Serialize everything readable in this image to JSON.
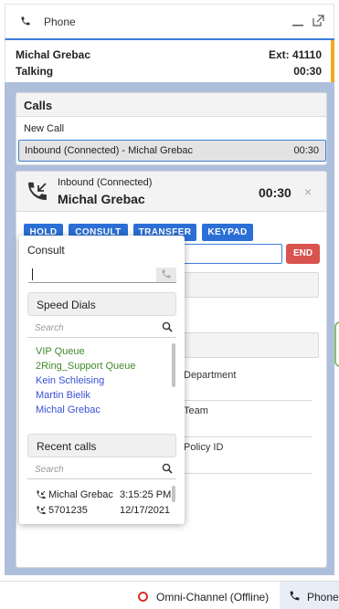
{
  "window": {
    "title": "Phone"
  },
  "status": {
    "name": "Michal Grebac",
    "ext": "Ext: 41110",
    "state": "Talking",
    "timer": "00:30"
  },
  "calls": {
    "header": "Calls",
    "new_call": "New Call",
    "active_call": {
      "label": "Inbound (Connected) - Michal Grebac",
      "time": "00:30"
    }
  },
  "detail": {
    "direction": "Inbound (Connected)",
    "name": "Michal Grebac",
    "timer": "00:30",
    "close": "×",
    "buttons": [
      "HOLD",
      "CONSULT",
      "TRANSFER",
      "KEYPAD"
    ],
    "end_button": "END",
    "labels": [
      "Department",
      "Team",
      "Policy ID"
    ]
  },
  "consult": {
    "title": "Consult",
    "speed_dials_header": "Speed Dials",
    "search_placeholder": "Search",
    "speed_dials": [
      {
        "label": "VIP Queue",
        "color": "#3f8a2a"
      },
      {
        "label": "2Ring_Support Queue",
        "color": "#3f8a2a"
      },
      {
        "label": "Kein Schleising",
        "color": "#3850d6"
      },
      {
        "label": "Martin Bielik",
        "color": "#3850d6"
      },
      {
        "label": "Michal Grebac",
        "color": "#3850d6"
      }
    ],
    "recent_header": "Recent calls",
    "recent_search_placeholder": "Search",
    "recent_calls": [
      {
        "name": "Michal Grebac",
        "time": "3:15:25 PM"
      },
      {
        "name": "5701235",
        "time": "12/17/2021"
      }
    ]
  },
  "bottom_bar": {
    "omni_channel": "Omni-Channel (Offline)",
    "phone": "Phone"
  },
  "colors": {
    "accent_blue": "#2b6fd6",
    "end_red": "#d9534f",
    "panel_bg": "#aebfdc",
    "status_accent": "#f4a91f"
  }
}
